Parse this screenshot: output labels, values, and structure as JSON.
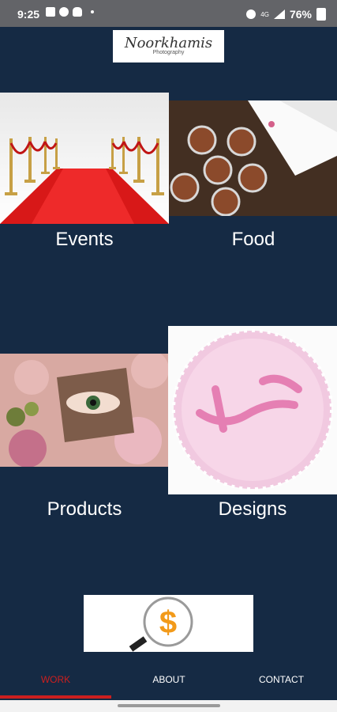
{
  "status": {
    "time": "9:25",
    "battery": "76%"
  },
  "header": {
    "logo_text": "Noorkhamis",
    "logo_sub": "Photography"
  },
  "categories": {
    "events": "Events",
    "food": "Food",
    "products": "Products",
    "designs": "Designs"
  },
  "payment": {
    "symbol": "$"
  },
  "nav": {
    "work": "WORK",
    "about": "ABOUT",
    "contact": "CONTACT"
  },
  "colors": {
    "background": "#152a44",
    "accent": "#cc1f1f",
    "status_bar": "#636468"
  }
}
